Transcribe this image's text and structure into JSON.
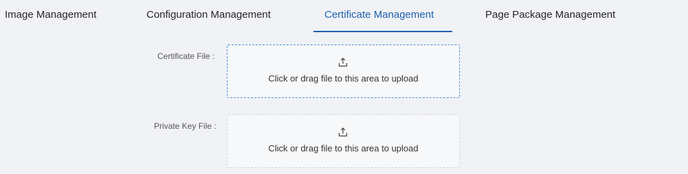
{
  "tabs": [
    {
      "label": "Image Management",
      "active": false
    },
    {
      "label": "Configuration Management",
      "active": false
    },
    {
      "label": "Certificate Management",
      "active": true
    },
    {
      "label": "Page Package Management",
      "active": false
    }
  ],
  "form": {
    "certificate": {
      "label": "Certificate File :",
      "hint": "Click or drag file to this area to upload",
      "icon": "upload-icon"
    },
    "private_key": {
      "label": "Private Key File :",
      "hint": "Click or drag file to this area to upload",
      "icon": "upload-icon"
    }
  },
  "colors": {
    "accent": "#1e5fae",
    "background": "#f0f2f5"
  }
}
